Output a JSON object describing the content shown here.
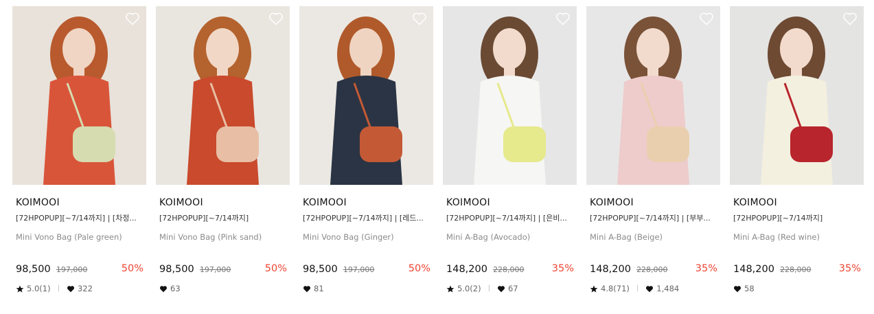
{
  "accent": {
    "discount": "#ef4533"
  },
  "products": [
    {
      "brand": "KOIMOOI",
      "promo": "[72HPOPUP][~7/14까지] | [차정...",
      "name": "Mini Vono Bag (Pale green)",
      "price": "98,500",
      "original_price": "197,000",
      "discount": "50%",
      "rating": "5.0(1)",
      "likes": "322",
      "show_rating": true,
      "photo": {
        "bg": "#e8e2da",
        "outfit": "#d9553a",
        "hair": "#b85a2e",
        "bag": "#d6dcb0",
        "skin": "#f0d5c4"
      }
    },
    {
      "brand": "KOIMOOI",
      "promo": "[72HPOPUP][~7/14까지]",
      "name": "Mini Vono Bag (Pink sand)",
      "price": "98,500",
      "original_price": "197,000",
      "discount": "50%",
      "rating": "",
      "likes": "63",
      "show_rating": false,
      "photo": {
        "bg": "#e9e6e0",
        "outfit": "#c94a2c",
        "hair": "#b4622e",
        "bag": "#e8bfa5",
        "skin": "#f1d7c6"
      }
    },
    {
      "brand": "KOIMOOI",
      "promo": "[72HPOPUP][~7/14까지] | [레드...",
      "name": "Mini Vono Bag (Ginger)",
      "price": "98,500",
      "original_price": "197,000",
      "discount": "50%",
      "rating": "",
      "likes": "81",
      "show_rating": false,
      "photo": {
        "bg": "#ebe8e3",
        "outfit": "#2b3444",
        "hair": "#b05a2b",
        "bag": "#c45a35",
        "skin": "#f0d4c2"
      }
    },
    {
      "brand": "KOIMOOI",
      "promo": "[72HPOPUP][~7/14까지] | [은비...",
      "name": "Mini A-Bag (Avocado)",
      "price": "148,200",
      "original_price": "228,000",
      "discount": "35%",
      "rating": "5.0(2)",
      "likes": "67",
      "show_rating": true,
      "photo": {
        "bg": "#e6e6e6",
        "outfit": "#f6f6f4",
        "hair": "#6b4a34",
        "bag": "#e6e98c",
        "skin": "#f2dbcd"
      }
    },
    {
      "brand": "KOIMOOI",
      "promo": "[72HPOPUP][~7/14까지] | [부부...",
      "name": "Mini A-Bag (Beige)",
      "price": "148,200",
      "original_price": "228,000",
      "discount": "35%",
      "rating": "4.8(71)",
      "likes": "1,484",
      "show_rating": true,
      "photo": {
        "bg": "#e7e7e7",
        "outfit": "#eecccc",
        "hair": "#7a5238",
        "bag": "#e9cfae",
        "skin": "#f2dbcd"
      }
    },
    {
      "brand": "KOIMOOI",
      "promo": "[72HPOPUP][~7/14까지]",
      "name": "Mini A-Bag (Red wine)",
      "price": "148,200",
      "original_price": "228,000",
      "discount": "35%",
      "rating": "",
      "likes": "58",
      "show_rating": false,
      "photo": {
        "bg": "#e4e4e2",
        "outfit": "#f4f0e0",
        "hair": "#6e4a33",
        "bag": "#b8252c",
        "skin": "#f2dbcd"
      }
    }
  ]
}
